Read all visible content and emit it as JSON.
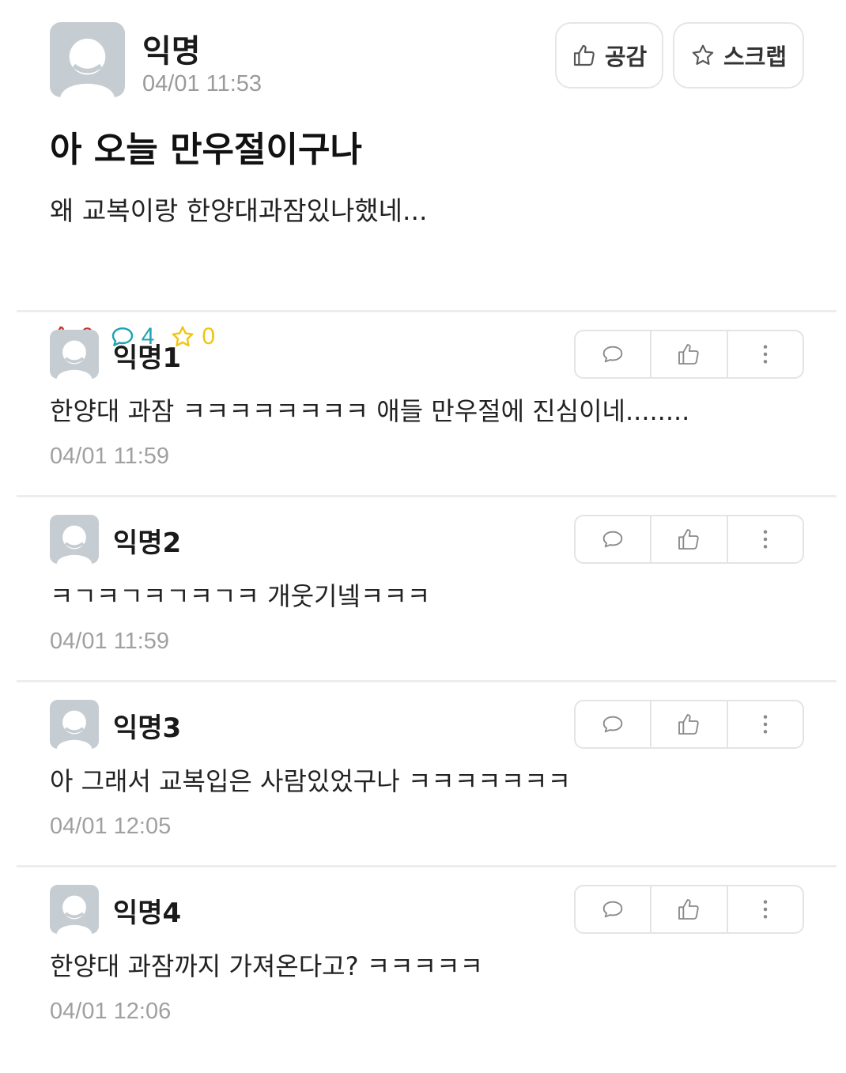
{
  "post": {
    "author": "익명",
    "time": "04/01 11:53",
    "title": "아 오늘 만우절이구나",
    "body": "왜 교복이랑 한양대과잠있나했네...",
    "like_button_label": "공감",
    "scrap_button_label": "스크랩",
    "stats": {
      "likes": "0",
      "comments": "4",
      "scraps": "0"
    }
  },
  "comments": [
    {
      "author": "익명1",
      "text": "한양대 과잠 ㅋㅋㅋㅋㅋㅋㅋㅋ 애들 만우절에 진심이네........",
      "time": "04/01 11:59"
    },
    {
      "author": "익명2",
      "text": "ㅋㄱㅋㄱㅋㄱㅋㄱㅋ 개웃기넼ㅋㅋㅋ",
      "time": "04/01 11:59"
    },
    {
      "author": "익명3",
      "text": "아 그래서 교복입은 사람있었구나 ㅋㅋㅋㅋㅋㅋㅋ",
      "time": "04/01 12:05"
    },
    {
      "author": "익명4",
      "text": "한양대 과잠까지 가져온다고? ㅋㅋㅋㅋㅋ",
      "time": "04/01 12:06"
    }
  ],
  "icons": {
    "thumbs_up": "thumbs-up-icon",
    "star": "star-icon",
    "speech_bubble": "speech-bubble-icon",
    "more": "more-vertical-icon"
  },
  "colors": {
    "like": "#c0392b",
    "comment": "#1fa3b3",
    "scrap": "#f1c40f",
    "muted_text": "#9a9a9a",
    "avatar_bg": "#c6cdd2"
  }
}
